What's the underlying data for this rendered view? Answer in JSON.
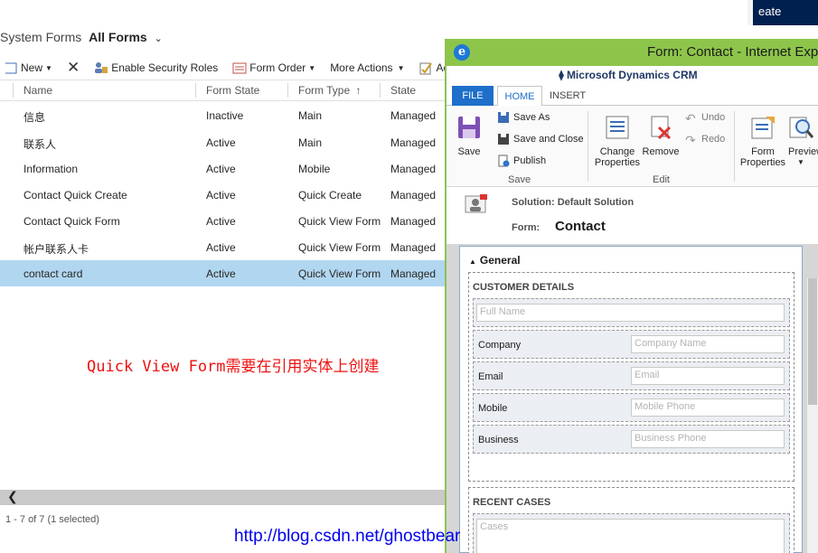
{
  "crm": {
    "top_right_fragment": "eate",
    "view_prefix": "System Forms",
    "view_name": "All Forms",
    "commands": {
      "new": "New",
      "enable_security_roles": "Enable Security Roles",
      "form_order": "Form Order",
      "more_actions": "More Actions",
      "activate_fragment": "Activ"
    },
    "columns": [
      "Name",
      "Form State",
      "Form Type",
      "State"
    ],
    "rows": [
      {
        "name": "信息",
        "state": "Inactive",
        "type": "Main",
        "solution_state": "Managed"
      },
      {
        "name": "联系人",
        "state": "Active",
        "type": "Main",
        "solution_state": "Managed"
      },
      {
        "name": "Information",
        "state": "Active",
        "type": "Mobile",
        "solution_state": "Managed"
      },
      {
        "name": "Contact Quick Create",
        "state": "Active",
        "type": "Quick Create",
        "solution_state": "Managed"
      },
      {
        "name": "Contact Quick Form",
        "state": "Active",
        "type": "Quick View Form",
        "solution_state": "Managed"
      },
      {
        "name": "帐户联系人卡",
        "state": "Active",
        "type": "Quick View Form",
        "solution_state": "Managed"
      },
      {
        "name": "contact card",
        "state": "Active",
        "type": "Quick View Form",
        "solution_state": "Managed",
        "selected": true
      }
    ],
    "annotation": "Quick View Form需要在引用实体上创建",
    "record_count": "1 - 7 of 7 (1 selected)",
    "blog_url": "http://blog.csdn.net/ghostbear"
  },
  "ie": {
    "title": "Form: Contact - Internet Explo",
    "brand": "Microsoft Dynamics CRM",
    "tabs": {
      "file": "FILE",
      "home": "HOME",
      "insert": "INSERT"
    },
    "ribbon": {
      "save": "Save",
      "save_as": "Save As",
      "save_and_close": "Save and Close",
      "publish": "Publish",
      "group_save": "Save",
      "change_properties_1": "Change",
      "change_properties_2": "Properties",
      "remove": "Remove",
      "undo": "Undo",
      "redo": "Redo",
      "group_edit": "Edit",
      "form_properties_1": "Form",
      "form_properties_2": "Properties",
      "preview": "Preview"
    },
    "solution_label": "Solution: Default Solution",
    "form_label": "Form:",
    "form_name": "Contact",
    "tab_name": "General",
    "sections": [
      {
        "title": "CUSTOMER DETAILS",
        "fields": [
          {
            "label": "",
            "placeholder": "Full Name"
          },
          {
            "label": "Company",
            "placeholder": "Company Name"
          },
          {
            "label": "Email",
            "placeholder": "Email"
          },
          {
            "label": "Mobile",
            "placeholder": "Mobile Phone"
          },
          {
            "label": "Business",
            "placeholder": "Business Phone"
          }
        ]
      },
      {
        "title": "RECENT CASES",
        "fields": [
          {
            "label": "",
            "placeholder": "Cases"
          }
        ]
      }
    ]
  },
  "colors": {
    "ie_titlebar": "#8dc54b",
    "selected_row": "#b1d6f0",
    "file_tab": "#1e6fc9",
    "annotation": "#ee1111",
    "crm_header": "#002050"
  }
}
